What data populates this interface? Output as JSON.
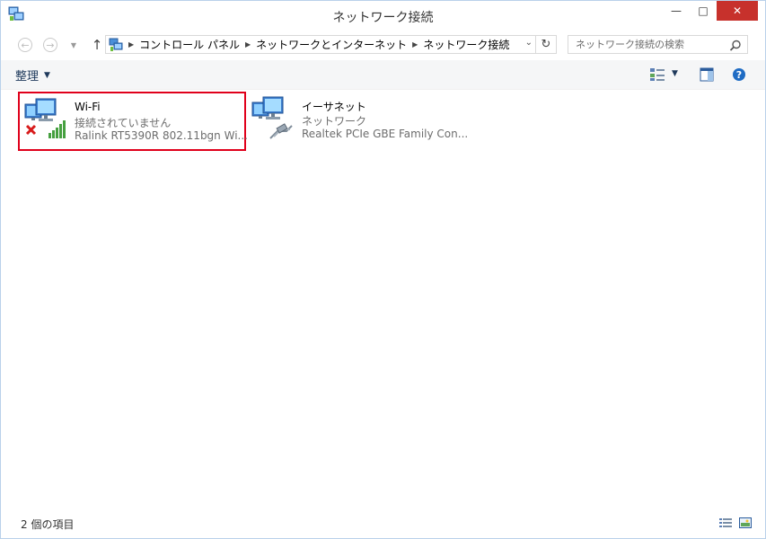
{
  "window": {
    "title": "ネットワーク接続",
    "controls": {
      "minimize": "—",
      "maximize": "□",
      "close": "✕"
    }
  },
  "address": {
    "breadcrumbs": [
      "コントロール パネル",
      "ネットワークとインターネット",
      "ネットワーク接続"
    ],
    "search_placeholder": "ネットワーク接続の検索"
  },
  "toolbar": {
    "organize_label": "整理",
    "icons": [
      "change-view-icon",
      "preview-pane-icon",
      "help-icon"
    ]
  },
  "connections": [
    {
      "name": "Wi-Fi",
      "status": "接続されていません",
      "device": "Ralink RT5390R 802.11bgn Wi...",
      "type": "wireless",
      "state": "disconnected",
      "highlighted": true
    },
    {
      "name": "イーサネット",
      "status": "ネットワーク",
      "device": "Realtek PCIe GBE Family Con...",
      "type": "ethernet",
      "state": "connected",
      "highlighted": false
    }
  ],
  "statusbar": {
    "item_count": "2 個の項目"
  },
  "colors": {
    "highlight_border": "#e0001b",
    "close_button": "#c7312c",
    "organize_text": "#1e395b",
    "secondary_text": "#6d6d6d"
  }
}
